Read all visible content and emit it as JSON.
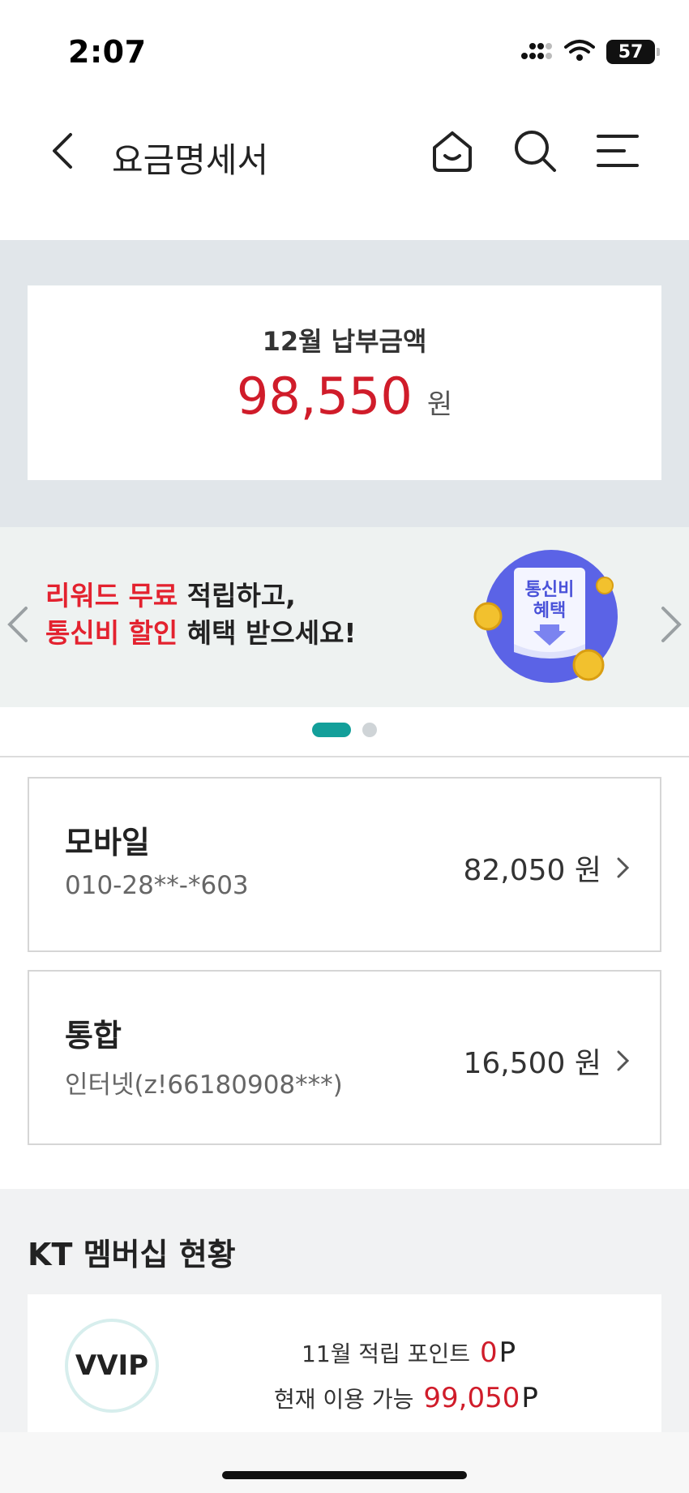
{
  "status_bar": {
    "time": "2:07",
    "battery": "57",
    "icons": [
      "signal-icon",
      "wifi-icon",
      "battery-icon"
    ]
  },
  "header": {
    "title": "요금명세서",
    "icons": [
      "back-arrow-icon",
      "home-icon",
      "search-icon",
      "menu-icon"
    ]
  },
  "payment": {
    "label": "12월 납부금액",
    "amount": "98,550",
    "unit": "원"
  },
  "banner": {
    "line1_highlight": "리워드 무료",
    "line1_rest": " 적립하고,",
    "line2_highlight": "통신비 할인",
    "line2_rest": " 혜택 받으세요!",
    "illustration_text_1": "통신비",
    "illustration_text_2": "혜택",
    "pager_total": 2,
    "pager_active": 1
  },
  "bills": [
    {
      "name": "모바일",
      "sub": "010-28**-*603",
      "amount": "82,050 원"
    },
    {
      "name": "통합",
      "sub": "인터넷(z!66180908***)",
      "amount": "16,500 원"
    }
  ],
  "membership": {
    "title": "KT 멤버십 현황",
    "grade": "VVIP",
    "earned_label": "11월 적립 포인트",
    "earned_value": "0",
    "available_label": "현재 이용 가능",
    "available_value": "99,050",
    "point_unit": "P"
  },
  "colors": {
    "accent_red": "#d01c2a",
    "pager_active": "#139f9a",
    "band_gray": "#e1e6ea"
  }
}
